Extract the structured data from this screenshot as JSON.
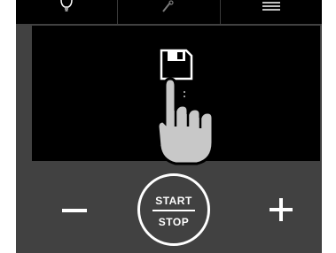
{
  "controls": {
    "start_label": "START",
    "stop_label": "STOP",
    "minus_icon": "minus-icon",
    "plus_icon": "plus-icon"
  },
  "top_tabs": [
    {
      "icon": "lightbulb-icon"
    },
    {
      "icon": "tools-icon"
    },
    {
      "icon": "menu-icon"
    }
  ],
  "screen": {
    "icon": "save-icon",
    "overlay": "pointing-hand-icon"
  },
  "colors": {
    "panel": "#414141",
    "screen": "#000000",
    "foreground": "#ffffff",
    "hand": "#c8c8c8"
  }
}
